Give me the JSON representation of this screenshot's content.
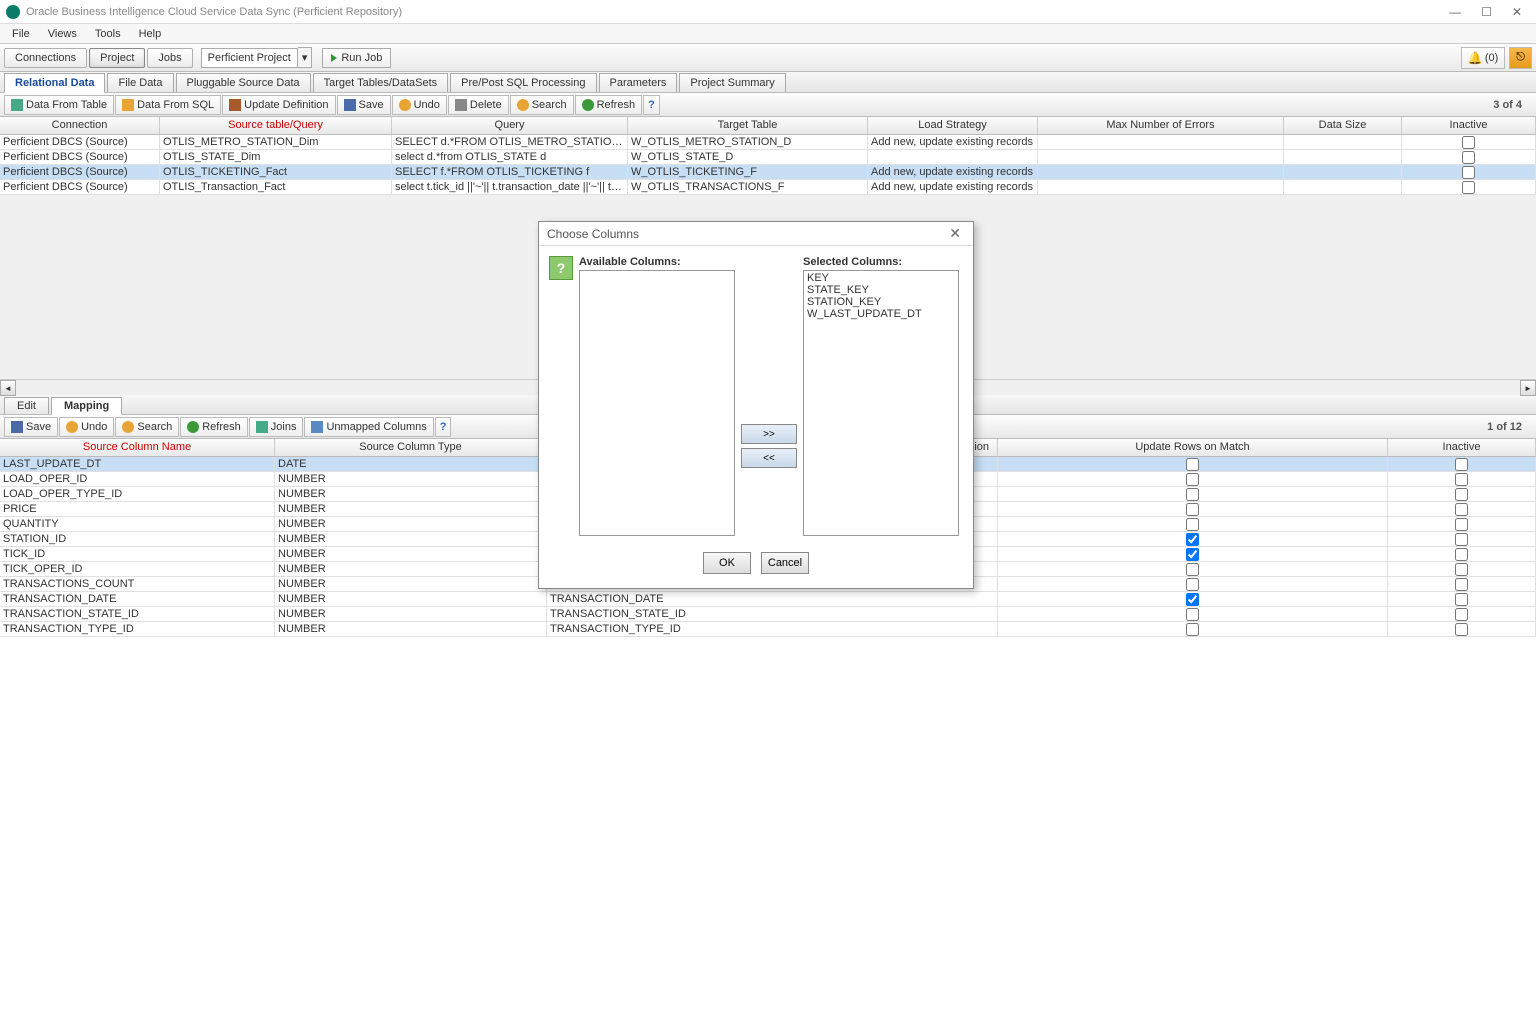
{
  "titlebar": {
    "title": "Oracle Business Intelligence Cloud Service Data Sync (Perficient Repository)"
  },
  "menubar": [
    "File",
    "Views",
    "Tools",
    "Help"
  ],
  "navTabs": {
    "connections": "Connections",
    "project": "Project",
    "jobs": "Jobs"
  },
  "projectCombo": "Perficient Project",
  "runJob": "Run Job",
  "bellCount": "(0)",
  "subTabs": [
    "Relational Data",
    "File Data",
    "Pluggable Source Data",
    "Target Tables/DataSets",
    "Pre/Post SQL Processing",
    "Parameters",
    "Project Summary"
  ],
  "upperActions": {
    "dataFromTable": "Data From Table",
    "dataFromSQL": "Data From SQL",
    "updateDefinition": "Update Definition",
    "save": "Save",
    "undo": "Undo",
    "delete": "Delete",
    "search": "Search",
    "refresh": "Refresh"
  },
  "upperStatus": "3 of 4",
  "upperHeaders": [
    "Connection",
    "Source table/Query",
    "Query",
    "Target Table",
    "Load Strategy",
    "Max Number of Errors",
    "Data Size",
    "Inactive"
  ],
  "upperRows": [
    {
      "conn": "Perficient DBCS (Source)",
      "src": "OTLIS_METRO_STATION_Dim",
      "query": "SELECT d.*FROM OTLIS_METRO_STATION d",
      "target": "W_OTLIS_METRO_STATION_D",
      "load": "Add new, update existing records",
      "max": "",
      "size": "",
      "inactive": false
    },
    {
      "conn": "Perficient DBCS (Source)",
      "src": "OTLIS_STATE_Dim",
      "query": "select d.*from OTLIS_STATE d",
      "target": "W_OTLIS_STATE_D",
      "load": "",
      "max": "",
      "size": "",
      "inactive": false
    },
    {
      "conn": "Perficient DBCS (Source)",
      "src": "OTLIS_TICKETING_Fact",
      "query": "SELECT f.*FROM OTLIS_TICKETING f",
      "target": "W_OTLIS_TICKETING_F",
      "load": "Add new, update existing records",
      "max": "",
      "size": "",
      "inactive": false,
      "selected": true
    },
    {
      "conn": "Perficient DBCS (Source)",
      "src": "OTLIS_Transaction_Fact",
      "query": "select t.tick_id ||'~'|| t.transaction_date ||'~'|| t.station_i...",
      "target": "W_OTLIS_TRANSACTIONS_F",
      "load": "Add new, update existing records",
      "max": "",
      "size": "",
      "inactive": false
    }
  ],
  "lowerTabs": [
    "Edit",
    "Mapping"
  ],
  "lowerActions": {
    "save": "Save",
    "undo": "Undo",
    "search": "Search",
    "refresh": "Refresh",
    "joins": "Joins",
    "unmapped": "Unmapped Columns"
  },
  "lowerStatus": "1 of 12",
  "lowerHeaders": {
    "srcName": "Source Column Name",
    "srcType": "Source Column Type",
    "ssion": "ssion",
    "update": "Update Rows on Match",
    "inactive": "Inactive"
  },
  "lowerRows": [
    {
      "name": "LAST_UPDATE_DT",
      "type": "DATE",
      "target": "",
      "update": false,
      "inactive": false,
      "selected": true
    },
    {
      "name": "LOAD_OPER_ID",
      "type": "NUMBER",
      "target": "",
      "update": false,
      "inactive": false
    },
    {
      "name": "LOAD_OPER_TYPE_ID",
      "type": "NUMBER",
      "target": "",
      "update": false,
      "inactive": false
    },
    {
      "name": "PRICE",
      "type": "NUMBER",
      "target": "",
      "update": false,
      "inactive": false
    },
    {
      "name": "QUANTITY",
      "type": "NUMBER",
      "target": "",
      "update": false,
      "inactive": false
    },
    {
      "name": "STATION_ID",
      "type": "NUMBER",
      "target": "",
      "update": true,
      "inactive": false
    },
    {
      "name": "TICK_ID",
      "type": "NUMBER",
      "target": "",
      "update": true,
      "inactive": false
    },
    {
      "name": "TICK_OPER_ID",
      "type": "NUMBER",
      "target": "",
      "update": false,
      "inactive": false
    },
    {
      "name": "TRANSACTIONS_COUNT",
      "type": "NUMBER",
      "target": "",
      "update": false,
      "inactive": false
    },
    {
      "name": "TRANSACTION_DATE",
      "type": "NUMBER",
      "target": "TRANSACTION_DATE",
      "update": true,
      "inactive": false
    },
    {
      "name": "TRANSACTION_STATE_ID",
      "type": "NUMBER",
      "target": "TRANSACTION_STATE_ID",
      "update": false,
      "inactive": false
    },
    {
      "name": "TRANSACTION_TYPE_ID",
      "type": "NUMBER",
      "target": "TRANSACTION_TYPE_ID",
      "update": false,
      "inactive": false
    }
  ],
  "dialog": {
    "title": "Choose Columns",
    "availLabel": "Available Columns:",
    "selLabel": "Selected Columns:",
    "selected": [
      "KEY",
      "STATE_KEY",
      "STATION_KEY",
      "W_LAST_UPDATE_DT"
    ],
    "add": ">>",
    "remove": "<<",
    "ok": "OK",
    "cancel": "Cancel"
  }
}
